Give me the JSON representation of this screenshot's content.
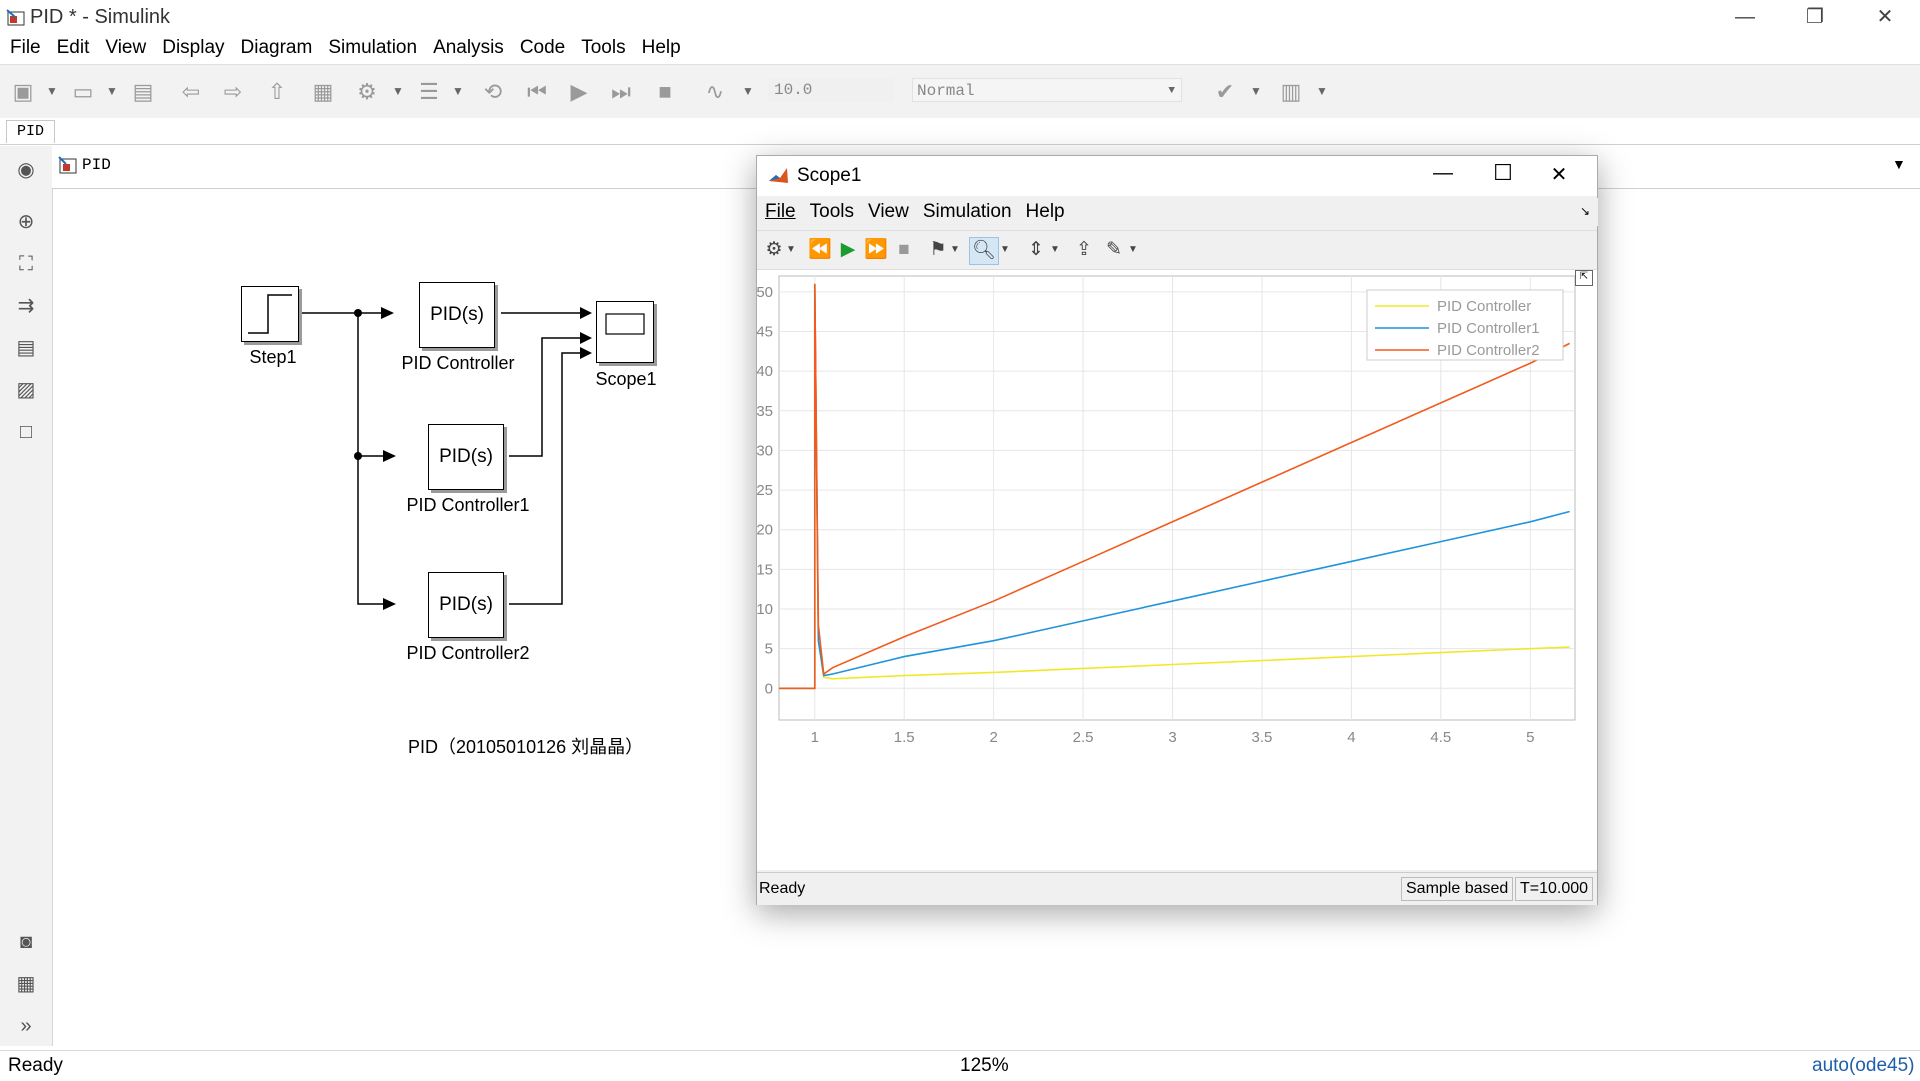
{
  "window": {
    "title": "PID * - Simulink",
    "minimize": "—",
    "restore": "❐",
    "close": "✕"
  },
  "menu": [
    "File",
    "Edit",
    "View",
    "Display",
    "Diagram",
    "Simulation",
    "Analysis",
    "Code",
    "Tools",
    "Help"
  ],
  "toolbar": {
    "stop_time": "10.0",
    "sim_mode": "Normal"
  },
  "tab": {
    "label": "PID"
  },
  "address": {
    "path": "PID"
  },
  "diagram": {
    "step_label": "Step1",
    "pid_block_text": "PID(s)",
    "pid1_label": "PID Controller",
    "pid2_label": "PID Controller1",
    "pid3_label": "PID Controller2",
    "scope_label": "Scope1",
    "annotation": "PID（20105010126 刘晶晶）"
  },
  "status": {
    "left": "Ready",
    "zoom": "125%",
    "solver": "auto(ode45)"
  },
  "scope": {
    "title": "Scope1",
    "menu": [
      "File",
      "Tools",
      "View",
      "Simulation",
      "Help"
    ],
    "status_left": "Ready",
    "status_mode": "Sample based",
    "status_time": "T=10.000",
    "win_min": "—",
    "win_max": "☐",
    "win_close": "✕"
  },
  "colors": {
    "series1": "#f2e82b",
    "series2": "#1e94dc",
    "series3": "#f25a1e",
    "grid": "#e6e6e6",
    "tick": "#888888"
  },
  "chart_data": {
    "type": "line",
    "xlim": [
      0.8,
      5.25
    ],
    "ylim": [
      -4,
      52
    ],
    "x_ticks": [
      1,
      1.5,
      2,
      2.5,
      3,
      3.5,
      4,
      4.5,
      5
    ],
    "y_ticks": [
      0,
      5,
      10,
      15,
      20,
      25,
      30,
      35,
      40,
      45,
      50
    ],
    "grid": true,
    "legend_position": "top-right",
    "series": [
      {
        "name": "PID Controller",
        "color": "#f2e82b",
        "x": [
          0.8,
          1.0,
          1.0,
          1.02,
          1.05,
          1.1,
          1.5,
          2,
          2.5,
          3,
          3.5,
          4,
          4.5,
          5,
          5.22
        ],
        "y": [
          0,
          0,
          51,
          6,
          1.4,
          1.2,
          1.6,
          2.0,
          2.5,
          3.0,
          3.5,
          4.0,
          4.5,
          5.0,
          5.2
        ]
      },
      {
        "name": "PID Controller1",
        "color": "#1e94dc",
        "x": [
          0.8,
          1.0,
          1.0,
          1.02,
          1.05,
          1.1,
          1.5,
          2,
          2.5,
          3,
          3.5,
          4,
          4.5,
          5,
          5.22
        ],
        "y": [
          0,
          0,
          51,
          6,
          1.6,
          1.8,
          4.0,
          6.0,
          8.5,
          11.0,
          13.5,
          16.0,
          18.5,
          21.0,
          22.3
        ]
      },
      {
        "name": "PID Controller2",
        "color": "#f25a1e",
        "x": [
          0.8,
          1.0,
          1.0,
          1.02,
          1.05,
          1.1,
          1.5,
          2,
          2.5,
          3,
          3.5,
          4,
          4.5,
          5,
          5.22
        ],
        "y": [
          0,
          0,
          51,
          8,
          1.8,
          2.6,
          6.5,
          11.0,
          16.0,
          21.0,
          26.0,
          31.0,
          36.0,
          41.0,
          43.5
        ]
      }
    ]
  }
}
